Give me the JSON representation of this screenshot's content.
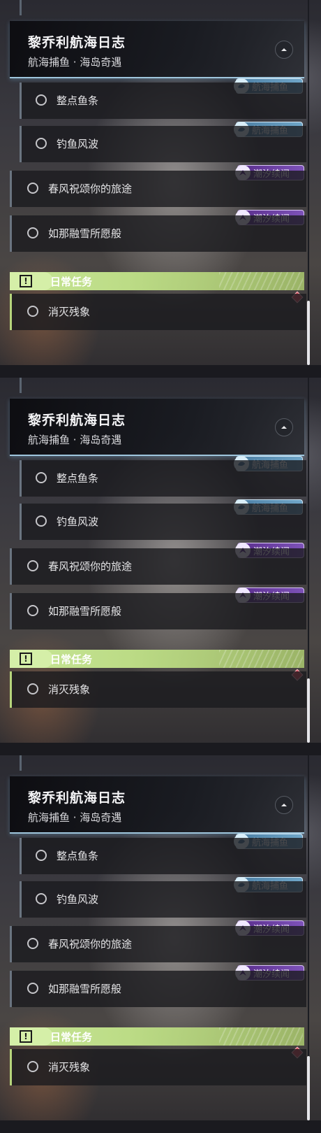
{
  "quest_group": {
    "title": "黎乔利航海日志",
    "subtitle": "航海捕鱼 · 海岛奇遇"
  },
  "tags": {
    "fishing": "航海捕鱼",
    "tide": "潮汐续闻"
  },
  "quests": [
    {
      "label": "整点鱼条",
      "tag": "航海捕鱼",
      "type": "sub"
    },
    {
      "label": "钓鱼风波",
      "tag": "航海捕鱼",
      "type": "sub"
    },
    {
      "label": "春风祝颂你的旅途",
      "tag": "潮汐续闻",
      "type": "main"
    },
    {
      "label": "如那融雪所愿般",
      "tag": "潮汐续闻",
      "type": "main"
    }
  ],
  "daily": {
    "title": "日常任务",
    "icon_text": "!",
    "quests": [
      {
        "label": "消灭残象"
      }
    ]
  },
  "icons": {
    "collapse": "chevron-up-icon",
    "fishing": "fishing-badge-icon",
    "tide": "tide-badge-icon",
    "daily": "alert-icon",
    "alert_marker": "diamond-alert-icon"
  },
  "colors": {
    "accent_blue": "#9fc6dd",
    "fishing_tag": "#4c7ea3",
    "tide_tag": "#5a2e8c",
    "daily_green": "#c7e596",
    "alert_red": "#d94a5a"
  }
}
